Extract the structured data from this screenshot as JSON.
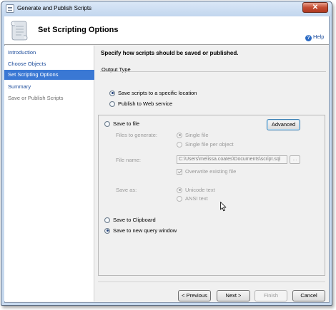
{
  "window": {
    "title": "Generate and Publish Scripts",
    "close_symbol": "✕"
  },
  "header": {
    "title": "Set Scripting Options",
    "icon": "scroll-icon"
  },
  "sidebar": {
    "items": [
      {
        "label": "Introduction",
        "state": "link"
      },
      {
        "label": "Choose Objects",
        "state": "link"
      },
      {
        "label": "Set Scripting Options",
        "state": "selected"
      },
      {
        "label": "Summary",
        "state": "link"
      },
      {
        "label": "Save or Publish Scripts",
        "state": "disabled"
      }
    ]
  },
  "help": {
    "label": "Help",
    "icon": "help-icon"
  },
  "instruction": "Specify how scripts should be saved or published.",
  "output_type": {
    "label": "Output Type",
    "options": [
      {
        "label": "Save scripts to a specific location",
        "selected": true
      },
      {
        "label": "Publish to Web service",
        "selected": false
      }
    ]
  },
  "save_panel": {
    "save_to_file": {
      "label": "Save to file",
      "selected": false
    },
    "advanced_button": "Advanced",
    "files_to_generate": {
      "label": "Files to generate:",
      "options": [
        {
          "label": "Single file",
          "selected": true
        },
        {
          "label": "Single file per object",
          "selected": false
        }
      ]
    },
    "file_name": {
      "label": "File name:",
      "value": "C:\\Users\\melissa.coates\\Documents\\script.sql",
      "browse_label": "..."
    },
    "overwrite": {
      "label": "Overwrite existing file",
      "checked": true
    },
    "save_as": {
      "label": "Save as:",
      "options": [
        {
          "label": "Unicode text",
          "selected": true
        },
        {
          "label": "ANSI text",
          "selected": false
        }
      ]
    },
    "save_to_clipboard": {
      "label": "Save to Clipboard",
      "selected": false
    },
    "save_to_query_window": {
      "label": "Save to new query window",
      "selected": true
    }
  },
  "footer": {
    "previous": "< Previous",
    "next": "Next >",
    "finish": "Finish",
    "cancel": "Cancel"
  },
  "colors": {
    "selected_nav": "#3a78d4",
    "link": "#1a4a9a",
    "close_button": "#c44d33"
  }
}
